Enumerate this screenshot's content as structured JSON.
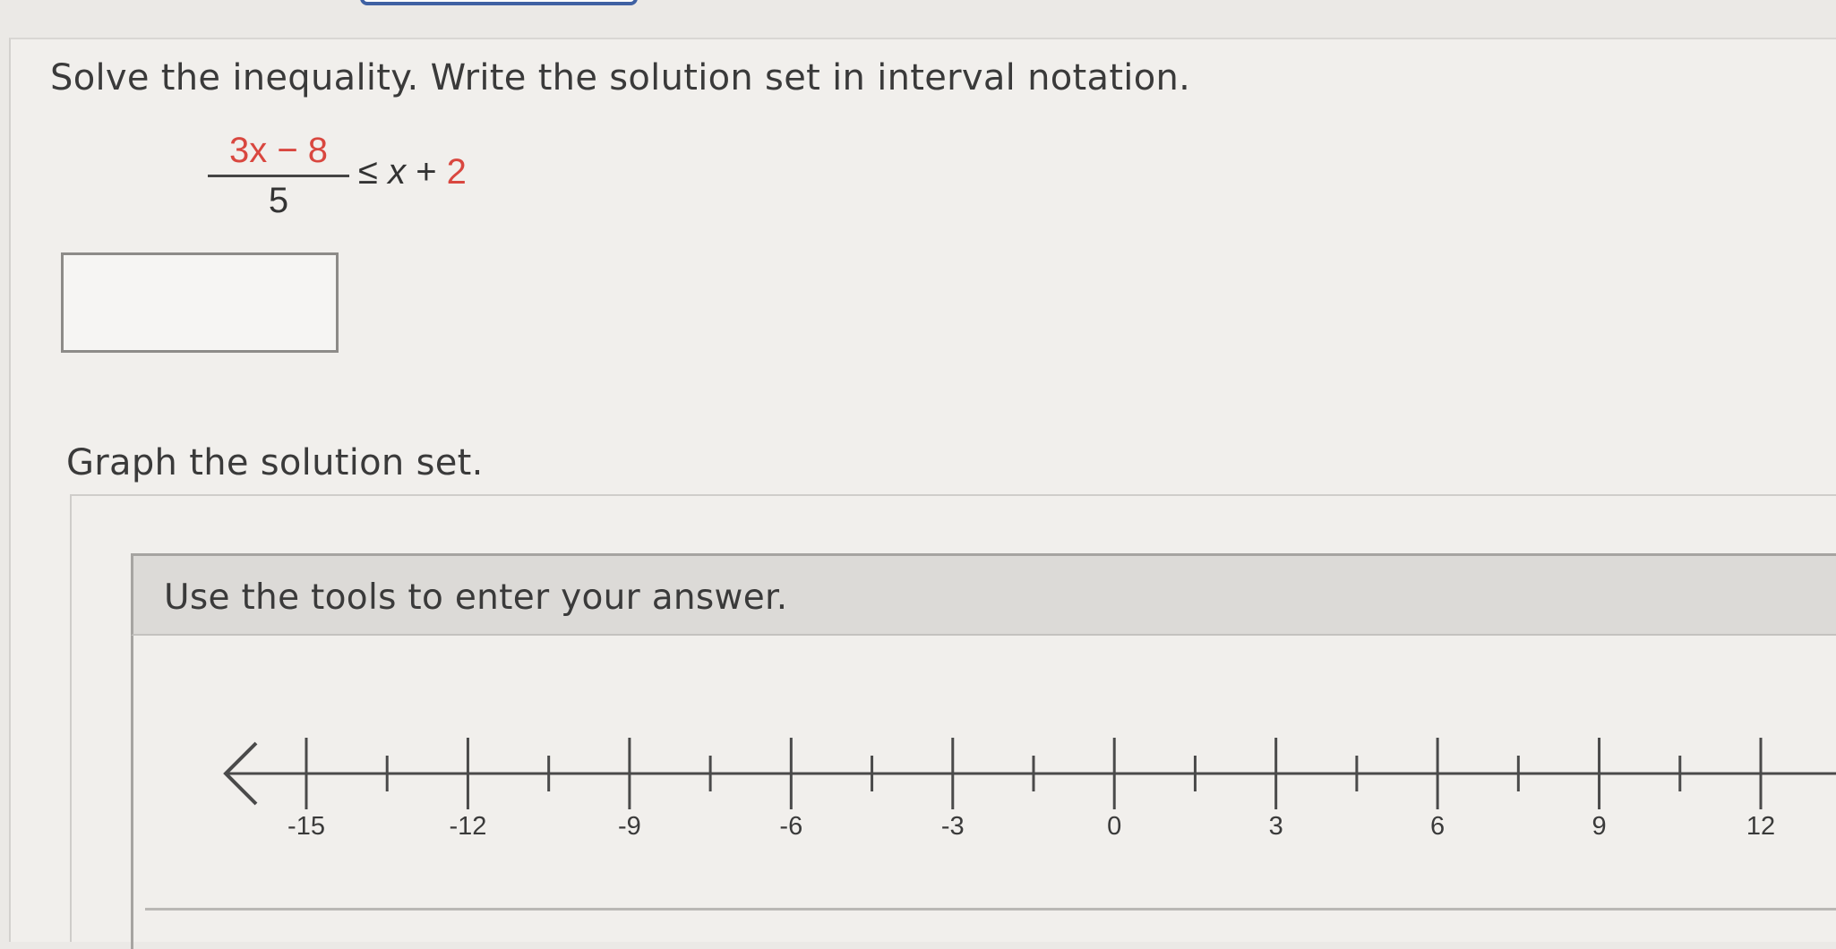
{
  "question": {
    "prompt": "Solve the inequality. Write the solution set in interval notation.",
    "inequality": {
      "numerator": "3x − 8",
      "denominator": "5",
      "relation": "≤",
      "variable": "x",
      "plus": " + ",
      "constant": "2"
    },
    "answer_value": ""
  },
  "graph": {
    "prompt": "Graph the solution set.",
    "tools_instruction": "Use the tools to enter your answer.",
    "tick_labels": [
      "-15",
      "-12",
      "-9",
      "-6",
      "-3",
      "0",
      "3",
      "6",
      "9",
      "12"
    ],
    "tick_values": [
      -15,
      -12,
      -9,
      -6,
      -3,
      0,
      3,
      6,
      9,
      12
    ],
    "minor_tick_values": [
      -13.5,
      -10.5,
      -7.5,
      -4.5,
      -1.5,
      1.5,
      4.5,
      7.5,
      10.5
    ],
    "arrow_left": true
  },
  "colors": {
    "accent_red": "#d9473f",
    "tab_blue": "#3f61a3"
  }
}
